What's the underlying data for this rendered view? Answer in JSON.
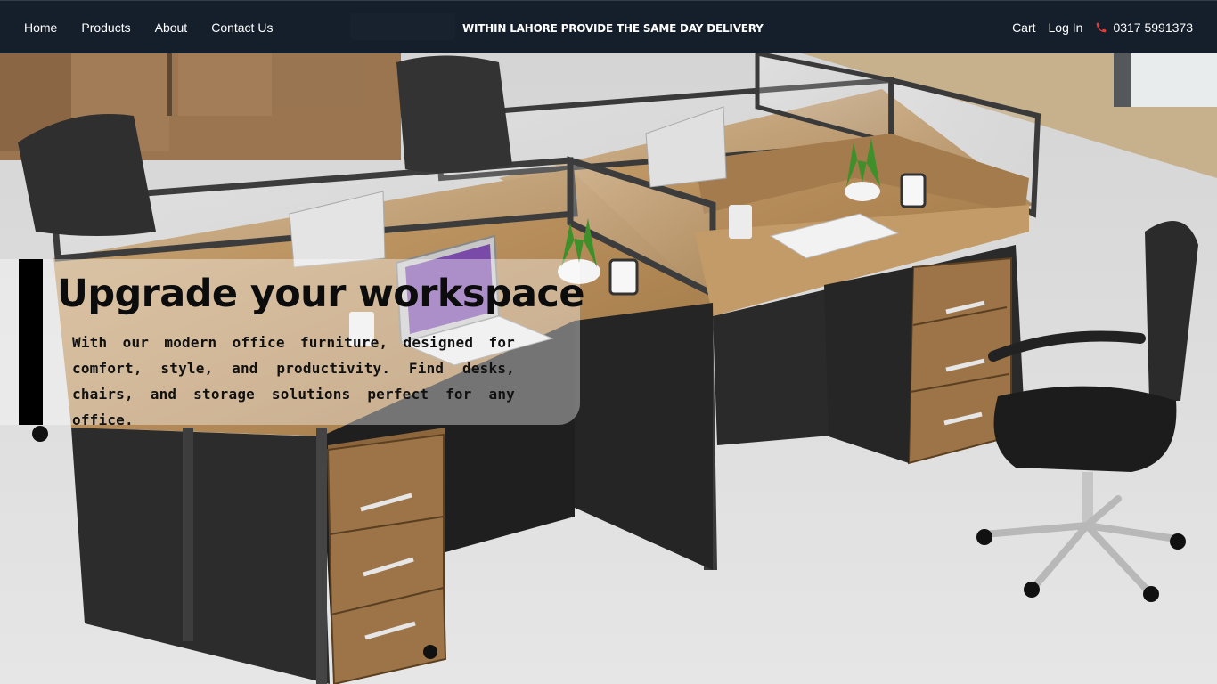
{
  "nav": {
    "links": [
      "Home",
      "Products",
      "About",
      "Contact Us"
    ],
    "banner": "WITHIN LAHORE PROVIDE THE SAME DAY DELIVERY",
    "cart_label": "Cart",
    "login_label": "Log In",
    "phone": "0317 5991373",
    "phone_icon": "phone-icon"
  },
  "hero": {
    "title": "Upgrade your workspace",
    "description": "With our modern office furniture, designed for comfort, style, and productivity. Find desks, chairs, and storage solutions perfect for any office.",
    "image": "office-workstation-photo"
  },
  "colors": {
    "nav_bg": "#151f2c",
    "accent_bar": "#000000",
    "phone_icon": "#e53935"
  }
}
